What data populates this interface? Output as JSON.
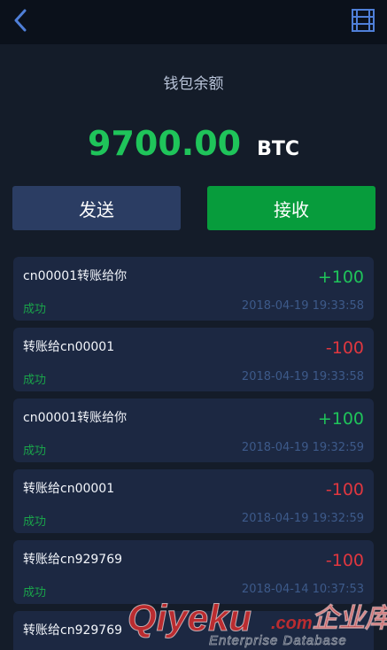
{
  "header": {
    "back_icon": "chevron-left-icon",
    "menu_icon": "list-menu-icon",
    "accent_color": "#4f7fd8"
  },
  "wallet": {
    "label": "钱包余额",
    "balance": "9700.00",
    "unit": "BTC",
    "balance_color": "#1fc45a"
  },
  "actions": {
    "send_label": "发送",
    "receive_label": "接收"
  },
  "transactions": [
    {
      "desc": "cn00001转账给你",
      "amount": "+100",
      "status": "成功",
      "time": "2018-04-19 19:33:58"
    },
    {
      "desc": "转账给cn00001",
      "amount": "-100",
      "status": "成功",
      "time": "2018-04-19 19:33:58"
    },
    {
      "desc": "cn00001转账给你",
      "amount": "+100",
      "status": "成功",
      "time": "2018-04-19 19:32:59"
    },
    {
      "desc": "转账给cn00001",
      "amount": "-100",
      "status": "成功",
      "time": "2018-04-19 19:32:59"
    },
    {
      "desc": "转账给cn929769",
      "amount": "-100",
      "status": "成功",
      "time": "2018-04-14 10:37:53"
    },
    {
      "desc": "转账给cn929769",
      "amount": "",
      "status": "",
      "time": ""
    }
  ],
  "watermark": {
    "brand": "Qiyeku",
    "domain": ".com",
    "cn_text": "企业库",
    "tagline": "Enterprise Database"
  }
}
